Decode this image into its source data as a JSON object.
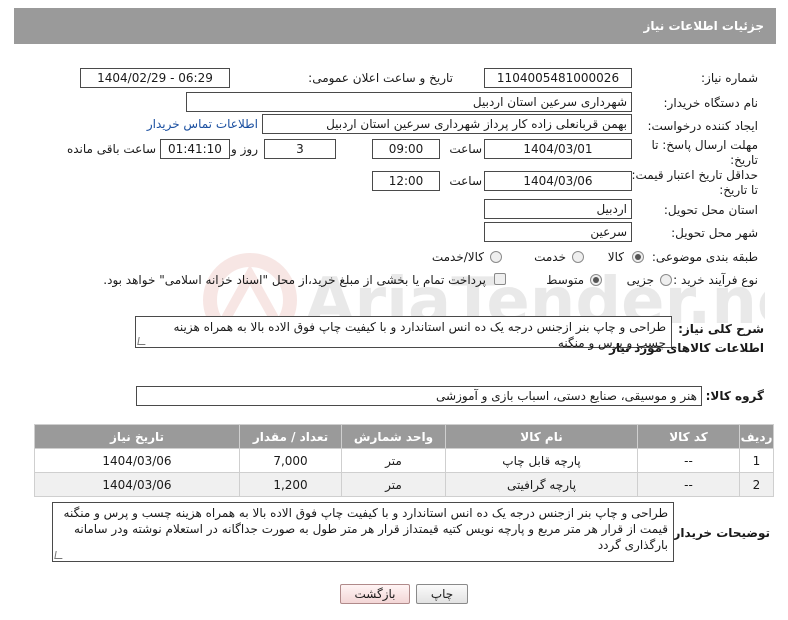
{
  "page": {
    "title": "جزئیات اطلاعات نیاز"
  },
  "form": {
    "need_number": {
      "label": "شماره نیاز:",
      "value": "1104005481000026"
    },
    "announce_datetime": {
      "label": "تاریخ و ساعت اعلان عمومی:",
      "value": "1404/02/29 - 06:29"
    },
    "buyer_org": {
      "label": "نام دستگاه خریدار:",
      "value": "شهرداری سرعین استان اردبیل"
    },
    "requester": {
      "label": "ایجاد کننده درخواست:",
      "value": "بهمن قربانعلی زاده کار پرداز شهرداری سرعین استان اردبیل",
      "contact_link": "اطلاعات تماس خریدار"
    },
    "reply_deadline": {
      "label": "مهلت ارسال پاسخ: تا تاریخ:",
      "date": "1404/03/01",
      "time_label": "ساعت",
      "time": "09:00",
      "days": "3",
      "days_label": "روز و",
      "remaining": "01:41:10",
      "remaining_label": "ساعت باقی مانده"
    },
    "price_validity": {
      "label": "حداقل تاریخ اعتبار قیمت: تا تاریخ:",
      "date": "1404/03/06",
      "time_label": "ساعت",
      "time": "12:00"
    },
    "delivery_province": {
      "label": "استان محل تحویل:",
      "value": "اردبیل"
    },
    "delivery_city": {
      "label": "شهر محل تحویل:",
      "value": "سرعین"
    },
    "category": {
      "label": "طبقه بندی موضوعی:",
      "options": [
        "کالا",
        "خدمت",
        "کالا/خدمت"
      ],
      "selected": "کالا"
    },
    "purchase_type": {
      "label": "نوع فرآیند خرید :",
      "options": [
        "جزیی",
        "متوسط"
      ],
      "payment_note": "پرداخت تمام یا بخشی از مبلغ خرید،از محل \"اسناد خزانه اسلامی\" خواهد بود."
    },
    "general_desc": {
      "label": "شرح کلی نیاز:",
      "value": "طراحی و چاپ بنر ازجنس درجه یک ده انس استاندارد و با کیفیت چاپ فوق الاده بالا به همراه هزینه چسب و پرس و منگنه"
    }
  },
  "goods": {
    "section_title": "اطلاعات کالاهای مورد نیاز",
    "group_label": "گروه کالا:",
    "group_value": "هنر و موسیقی، صنایع دستی، اسباب بازی و آموزشی",
    "columns": [
      "ردیف",
      "کد کالا",
      "نام کالا",
      "واحد شمارش",
      "تعداد / مقدار",
      "تاریخ نیاز"
    ],
    "rows": [
      {
        "row": "1",
        "code": "--",
        "name": "پارچه قابل چاپ",
        "unit": "متر",
        "qty": "7,000",
        "date": "1404/03/06"
      },
      {
        "row": "2",
        "code": "--",
        "name": "پارچه گرافیتی",
        "unit": "متر",
        "qty": "1,200",
        "date": "1404/03/06"
      }
    ]
  },
  "buyer_notes": {
    "label": "توضیحات خریدار:",
    "value": "طراحی و چاپ بنر ازجنس درجه یک ده انس استاندارد و با کیفیت چاپ فوق الاده بالا به همراه هزینه چسب و پرس و منگنه قیمت از قرار هر متر مربع و پارچه نویس کتیه قیمتداز قرار هر متر طول به صورت جداگانه در استعلام نوشته ودر سامانه بارگذاری گردد"
  },
  "buttons": {
    "print": "چاپ",
    "back": "بازگشت"
  },
  "watermark": {
    "text": "AriaTender.neT"
  }
}
